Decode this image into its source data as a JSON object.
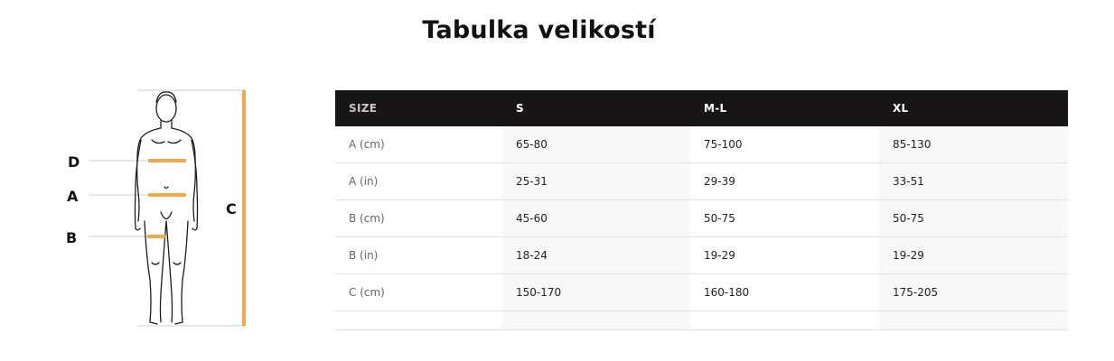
{
  "title": "Tabulka velikostí",
  "figure": {
    "labels": {
      "D": "D",
      "A": "A",
      "B": "B",
      "C": "C"
    },
    "accent_color": "#f0a945"
  },
  "table": {
    "headers": [
      "SIZE",
      "S",
      "M-L",
      "XL"
    ],
    "rows": [
      {
        "label": "A (cm)",
        "values": [
          "65-80",
          "75-100",
          "85-130"
        ]
      },
      {
        "label": "A (in)",
        "values": [
          "25-31",
          "29-39",
          "33-51"
        ]
      },
      {
        "label": "B (cm)",
        "values": [
          "45-60",
          "50-75",
          "50-75"
        ]
      },
      {
        "label": "B (in)",
        "values": [
          "18-24",
          "19-29",
          "19-29"
        ]
      },
      {
        "label": "C (cm)",
        "values": [
          "150-170",
          "160-180",
          "175-205"
        ]
      }
    ]
  }
}
